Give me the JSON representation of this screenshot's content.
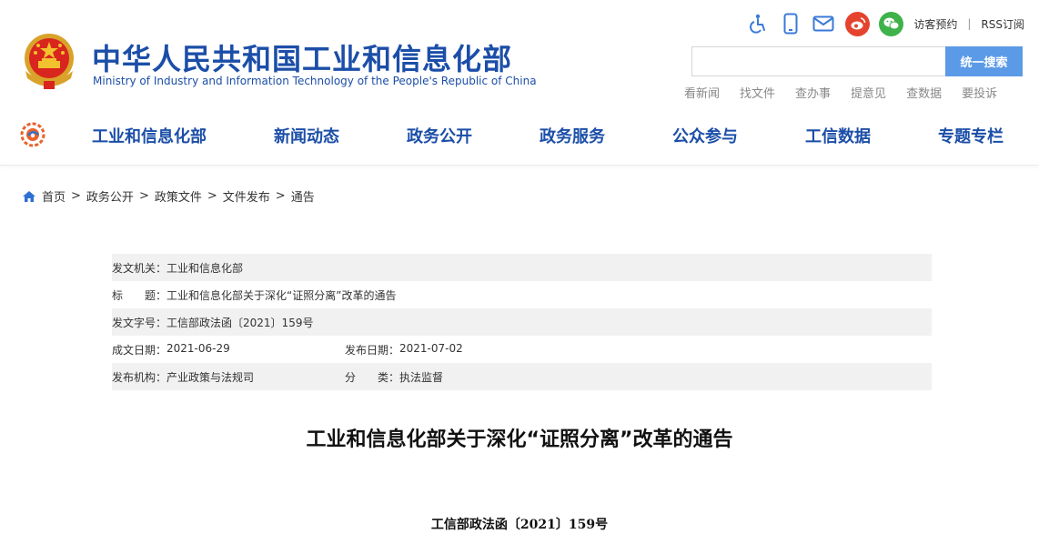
{
  "header": {
    "title": "中华人民共和国工业和信息化部",
    "subtitle": "Ministry of Industry and Information Technology of the People's Republic of China",
    "emblem_icon": "national-emblem-icon"
  },
  "tools": {
    "icons": [
      "accessibility-icon",
      "mobile-icon",
      "mail-icon",
      "weibo-icon",
      "wechat-icon"
    ],
    "visitor_booking": "访客预约",
    "separator": "|",
    "rss": "RSS订阅"
  },
  "search": {
    "placeholder": "",
    "value": "",
    "button_label": "统一搜索"
  },
  "quick_links": [
    "看新闻",
    "找文件",
    "查办事",
    "提意见",
    "查数据",
    "要投诉"
  ],
  "nav": {
    "logo_icon": "miit-logo-icon",
    "items": [
      "工业和信息化部",
      "新闻动态",
      "政务公开",
      "政务服务",
      "公众参与",
      "工信数据",
      "专题专栏"
    ]
  },
  "breadcrumb": {
    "items": [
      "首页",
      "政务公开",
      "政策文件",
      "文件发布",
      "通告"
    ],
    "separator": ">"
  },
  "meta": {
    "issuer_label": "发文机关：",
    "issuer": "工业和信息化部",
    "title_label": "标　　题：",
    "title": "工业和信息化部关于深化“证照分离”改革的通告",
    "docno_label": "发文字号：",
    "docno": "工信部政法函〔2021〕159号",
    "date_label": "成文日期：",
    "date": "2021-06-29",
    "pubdate_label": "发布日期：",
    "pubdate": "2021-07-02",
    "org_label": "发布机构：",
    "org": "产业政策与法规司",
    "category_label": "分　　类：",
    "category": "执法监督"
  },
  "article": {
    "title": "工业和信息化部关于深化“证照分离”改革的通告",
    "doc_number": "工信部政法函〔2021〕159号"
  },
  "colors": {
    "brand_blue": "#1b4ea8",
    "search_button": "#5b9ae6",
    "weibo": "#e6432e",
    "wechat": "#3fb24a",
    "row_shade": "#f1f1f1"
  }
}
